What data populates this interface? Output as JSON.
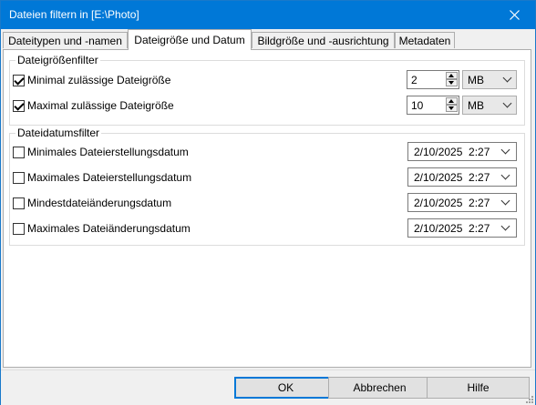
{
  "window": {
    "title": "Dateien filtern in [E:\\Photo]"
  },
  "tabs": [
    {
      "label": "Dateitypen und -namen",
      "active": false
    },
    {
      "label": "Dateigröße und Datum",
      "active": true
    },
    {
      "label": "Bildgröße und -ausrichtung",
      "active": false
    },
    {
      "label": "Metadaten",
      "active": false
    }
  ],
  "size_filter": {
    "legend": "Dateigrößenfilter",
    "rows": [
      {
        "label": "Minimal zulässige Dateigröße",
        "checked": true,
        "value": "2",
        "unit": "MB"
      },
      {
        "label": "Maximal zulässige Dateigröße",
        "checked": true,
        "value": "10",
        "unit": "MB"
      }
    ]
  },
  "date_filter": {
    "legend": "Dateidatumsfilter",
    "rows": [
      {
        "label": "Minimales Dateierstellungsdatum",
        "checked": false,
        "value": "2/10/2025  2:27"
      },
      {
        "label": "Maximales Dateierstellungsdatum",
        "checked": false,
        "value": "2/10/2025  2:27"
      },
      {
        "label": "Mindestdateiänderungsdatum",
        "checked": false,
        "value": "2/10/2025  2:27"
      },
      {
        "label": "Maximales Dateiänderungsdatum",
        "checked": false,
        "value": "2/10/2025  2:27"
      }
    ]
  },
  "buttons": {
    "ok": "OK",
    "cancel": "Abbrechen",
    "help": "Hilfe"
  },
  "colors": {
    "titlebar": "#0078d7",
    "default_button_border": "#0078d7"
  }
}
